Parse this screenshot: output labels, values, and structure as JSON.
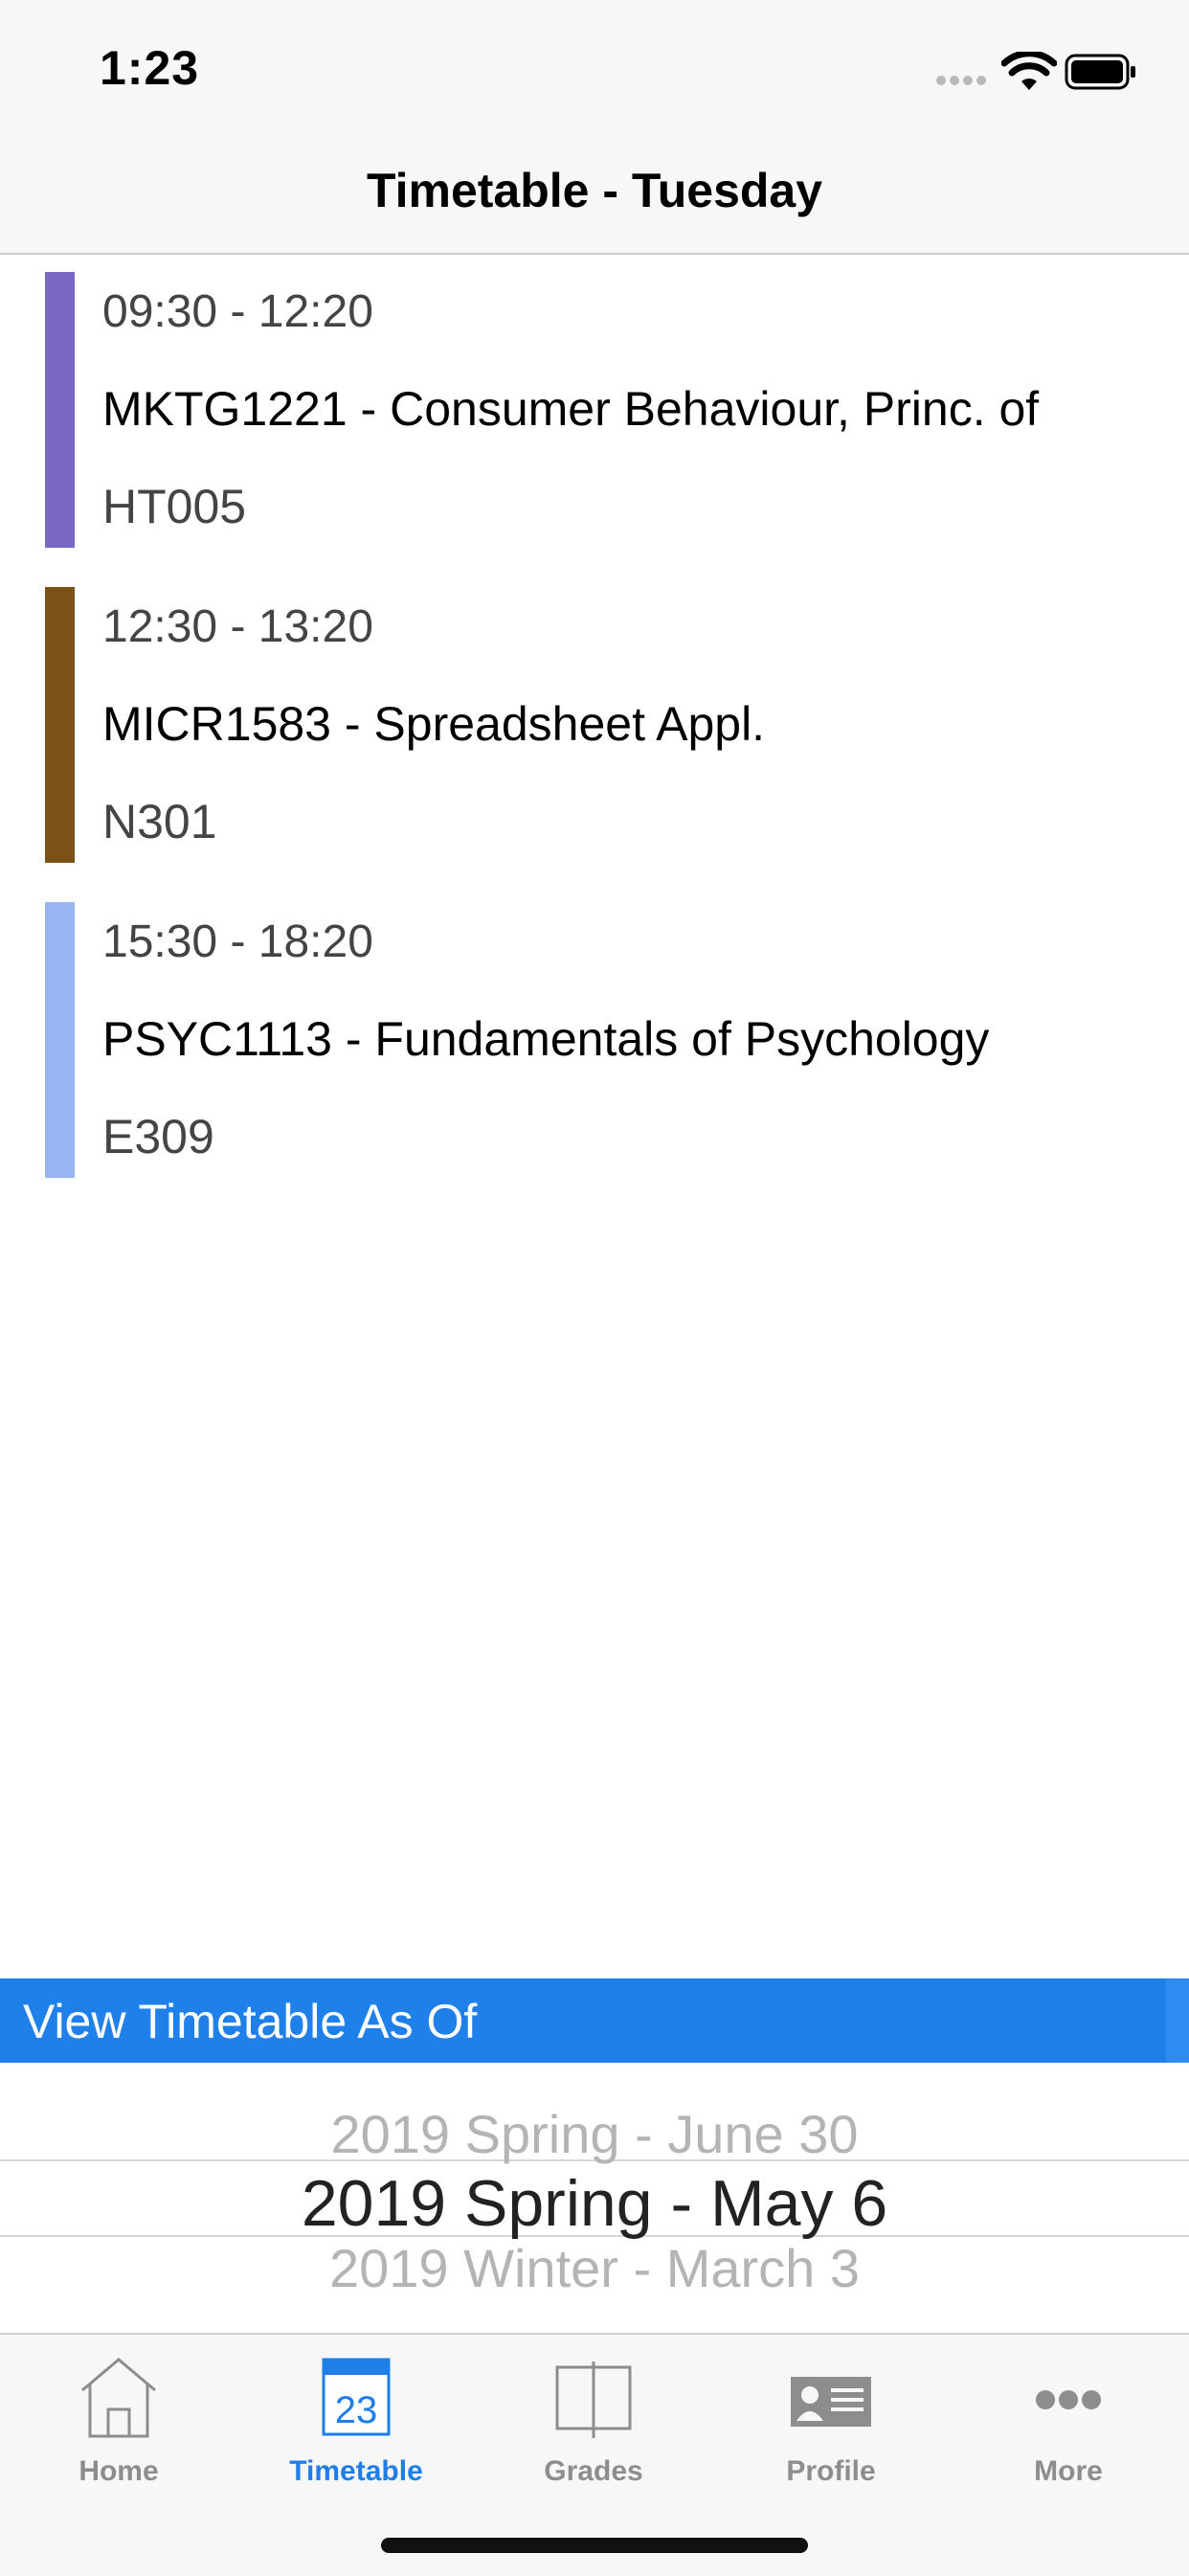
{
  "status_bar": {
    "time": "1:23"
  },
  "nav": {
    "title": "Timetable - Tuesday"
  },
  "classes": [
    {
      "time": "09:30 - 12:20",
      "name": "MKTG1221 - Consumer Behaviour, Princ. of",
      "room": "HT005",
      "color": "#7b67c4"
    },
    {
      "time": "12:30 - 13:20",
      "name": "MICR1583 - Spreadsheet Appl.",
      "room": "N301",
      "color": "#7b5117"
    },
    {
      "time": "15:30 - 18:20",
      "name": "PSYC1113 - Fundamentals of Psychology",
      "room": "E309",
      "color": "#99b5f1"
    }
  ],
  "picker": {
    "header": "View Timetable As Of",
    "options": [
      "2019 Spring - June 30",
      "2019 Spring - May 6",
      "2019 Winter - March 3"
    ],
    "selected": "2019 Spring - May 6",
    "header_color": "#1f80ea"
  },
  "tabs": [
    {
      "label": "Home",
      "icon": "home-icon"
    },
    {
      "label": "Timetable",
      "icon": "calendar-icon",
      "icon_text": "23",
      "active": true
    },
    {
      "label": "Grades",
      "icon": "book-icon"
    },
    {
      "label": "Profile",
      "icon": "profile-card-icon"
    },
    {
      "label": "More",
      "icon": "more-icon"
    }
  ],
  "colors": {
    "accent": "#1f7ee8",
    "inactive_tab": "#8d8d8d"
  }
}
